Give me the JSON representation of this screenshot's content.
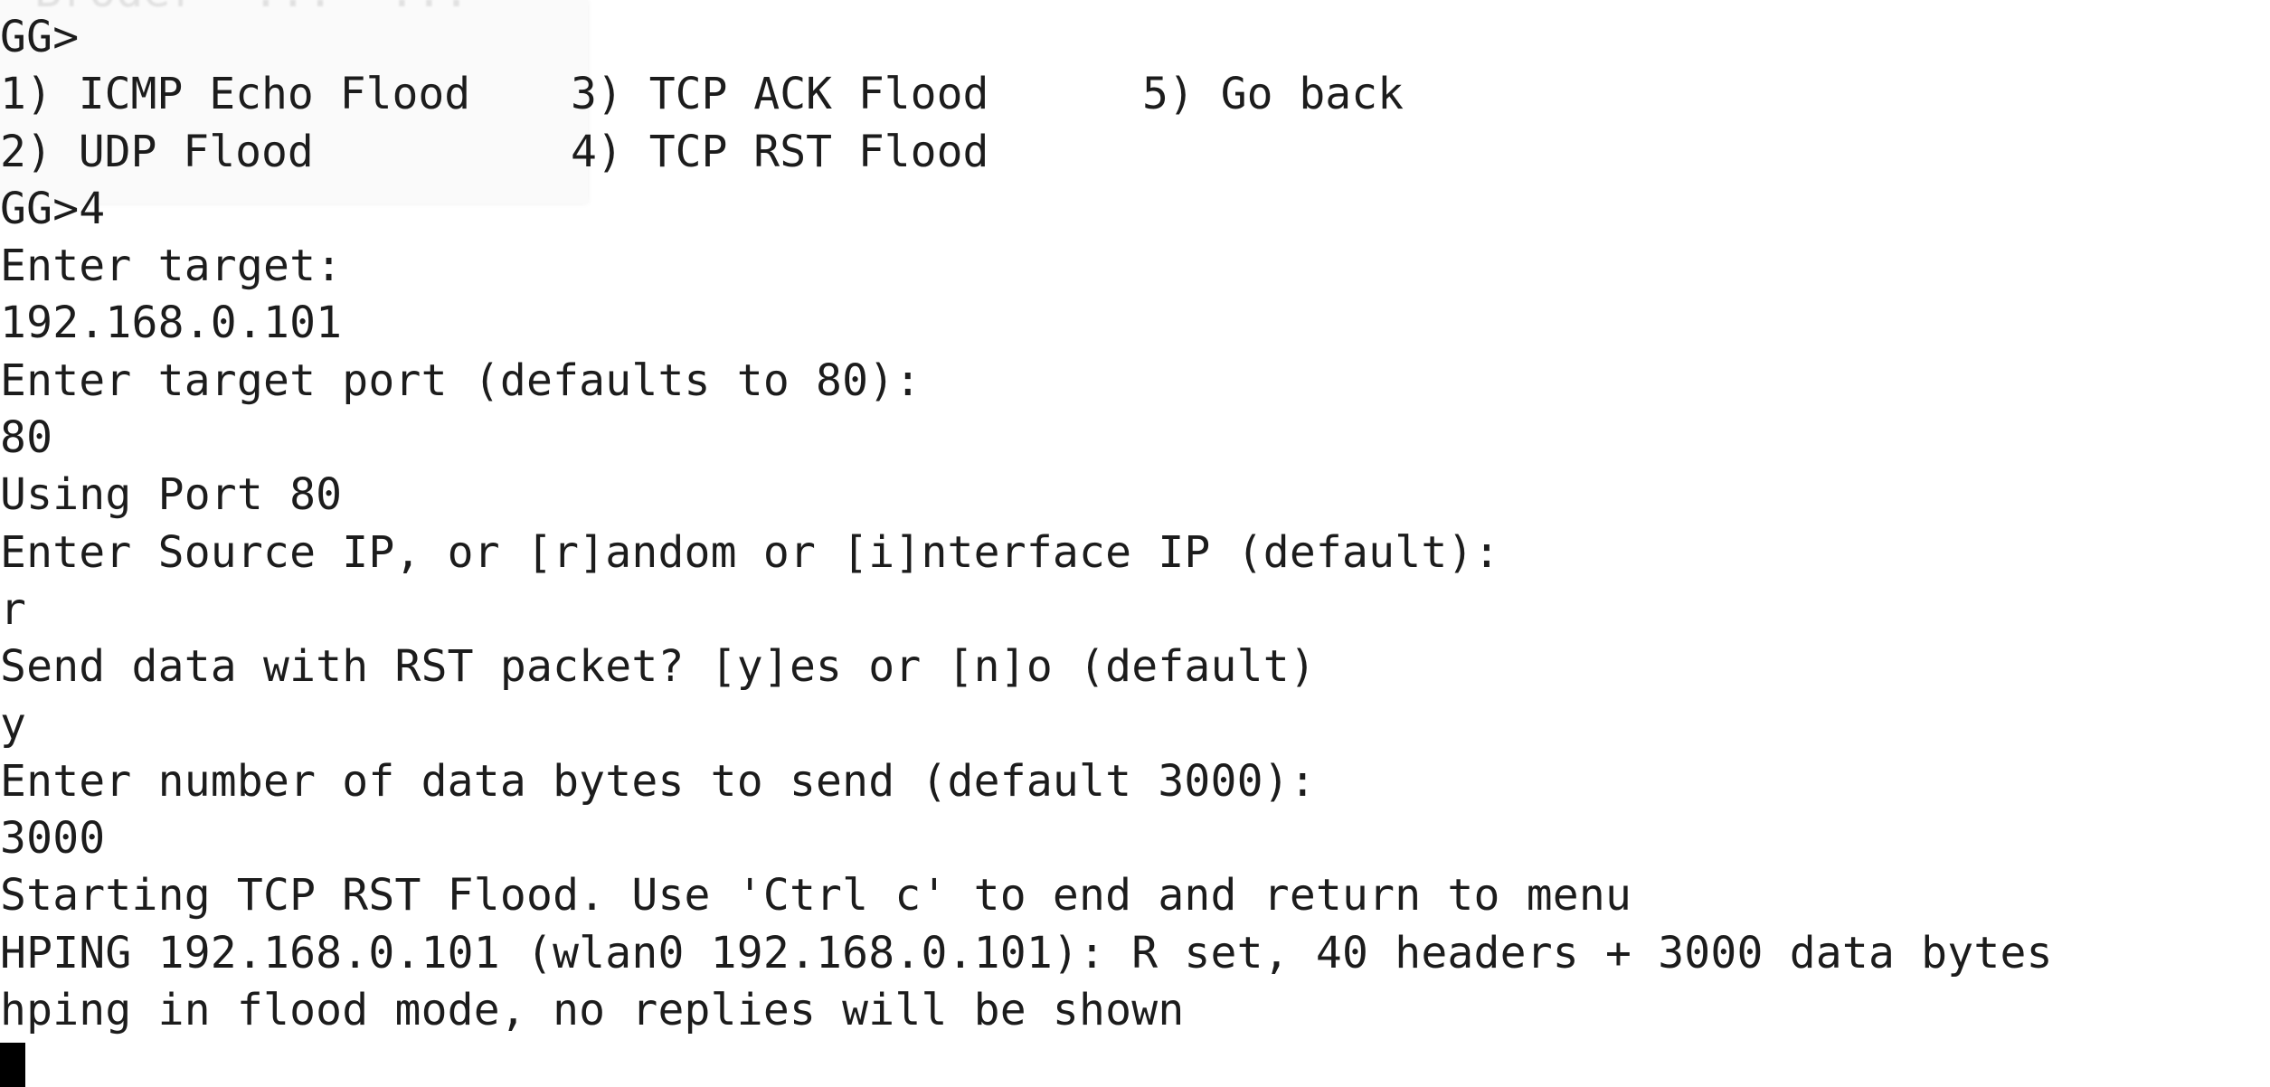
{
  "faded_text": "Broder  ...  ...",
  "prompt": "GG>",
  "menu": {
    "opt1": "1) ICMP Echo Flood",
    "opt2": "2) UDP Flood",
    "opt3": "3) TCP ACK Flood",
    "opt4": "4) TCP RST Flood",
    "opt5": "5) Go back"
  },
  "lines": {
    "choice": "GG>4",
    "enter_target": "Enter target:",
    "target_value": "192.168.0.101",
    "enter_port": "Enter target port (defaults to 80):",
    "port_value": "80",
    "using_port": "Using Port 80",
    "enter_source": "Enter Source IP, or [r]andom or [i]nterface IP (default):",
    "source_value": "r",
    "send_data": "Send data with RST packet? [y]es or [n]o (default)",
    "send_value": "y",
    "enter_bytes": "Enter number of data bytes to send (default 3000):",
    "bytes_value": "3000",
    "starting": "Starting TCP RST Flood. Use 'Ctrl c' to end and return to menu",
    "hping": "HPING 192.168.0.101 (wlan0 192.168.0.101): R set, 40 headers + 3000 data bytes",
    "flood_mode": "hping in flood mode, no replies will be shown"
  }
}
